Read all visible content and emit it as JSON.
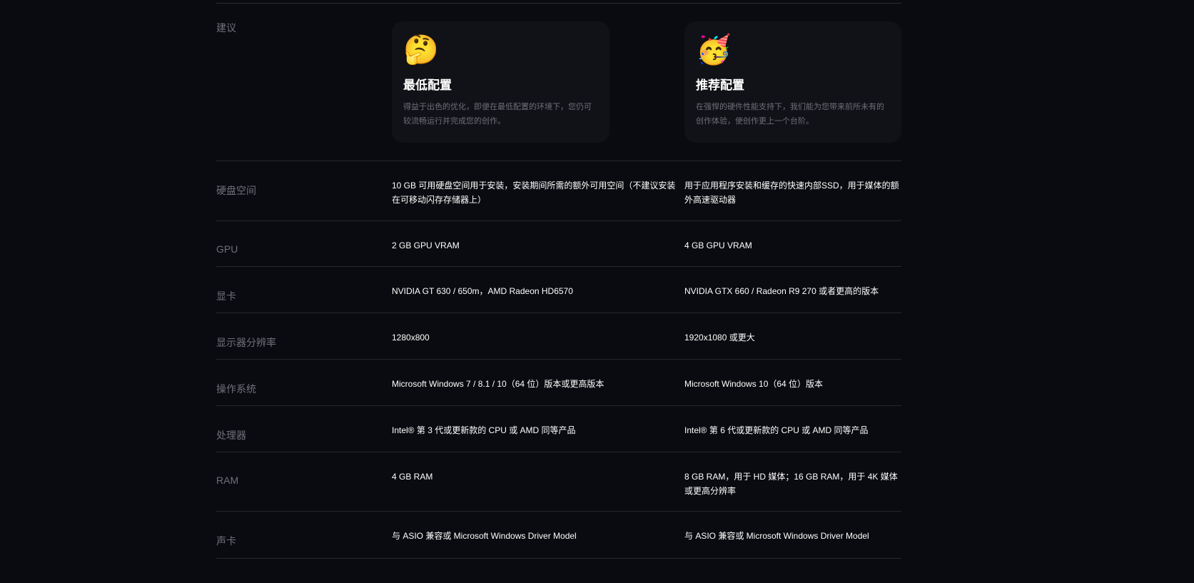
{
  "header_row": {
    "label": "建议",
    "min": {
      "emoji": "🤔",
      "emoji_name": "thinking-face",
      "title": "最低配置",
      "desc": "得益于出色的优化，即便在最低配置的环境下，您仍可较流畅运行并完成您的创作。"
    },
    "rec": {
      "emoji": "🥳",
      "emoji_name": "partying-face",
      "title": "推荐配置",
      "desc": "在强悍的硬件性能支持下，我们能为您带来前所未有的创作体验，使创作更上一个台阶。"
    }
  },
  "rows": [
    {
      "label": "硬盘空间",
      "min": "10 GB 可用硬盘空间用于安装，安装期间所需的额外可用空间（不建议安装在可移动闪存存储器上）",
      "rec": "用于应用程序安装和缓存的快速内部SSD，用于媒体的额外高速驱动器"
    },
    {
      "label": "GPU",
      "min": "2 GB GPU VRAM",
      "rec": "4 GB GPU VRAM"
    },
    {
      "label": "显卡",
      "min": "NVIDIA GT 630 / 650m，AMD Radeon HD6570",
      "rec": "NVIDIA GTX 660 / Radeon R9 270 或者更高的版本"
    },
    {
      "label": "显示器分辨率",
      "min": "1280x800",
      "rec": "1920x1080 或更大"
    },
    {
      "label": "操作系统",
      "min": "Microsoft Windows 7 / 8.1 / 10（64 位）版本或更高版本",
      "rec": "Microsoft Windows 10（64 位）版本"
    },
    {
      "label": "处理器",
      "min": "Intel® 第 3 代或更新款的 CPU 或 AMD 同等产品",
      "rec": "Intel® 第 6 代或更新款的 CPU 或 AMD 同等产品"
    },
    {
      "label": "RAM",
      "min": "4 GB RAM",
      "rec": "8 GB RAM，用于 HD 媒体；16 GB RAM，用于 4K 媒体或更高分辨率"
    },
    {
      "label": "声卡",
      "min": "与 ASIO 兼容或 Microsoft Windows Driver Model",
      "rec": "与 ASIO 兼容或 Microsoft Windows Driver Model"
    }
  ]
}
